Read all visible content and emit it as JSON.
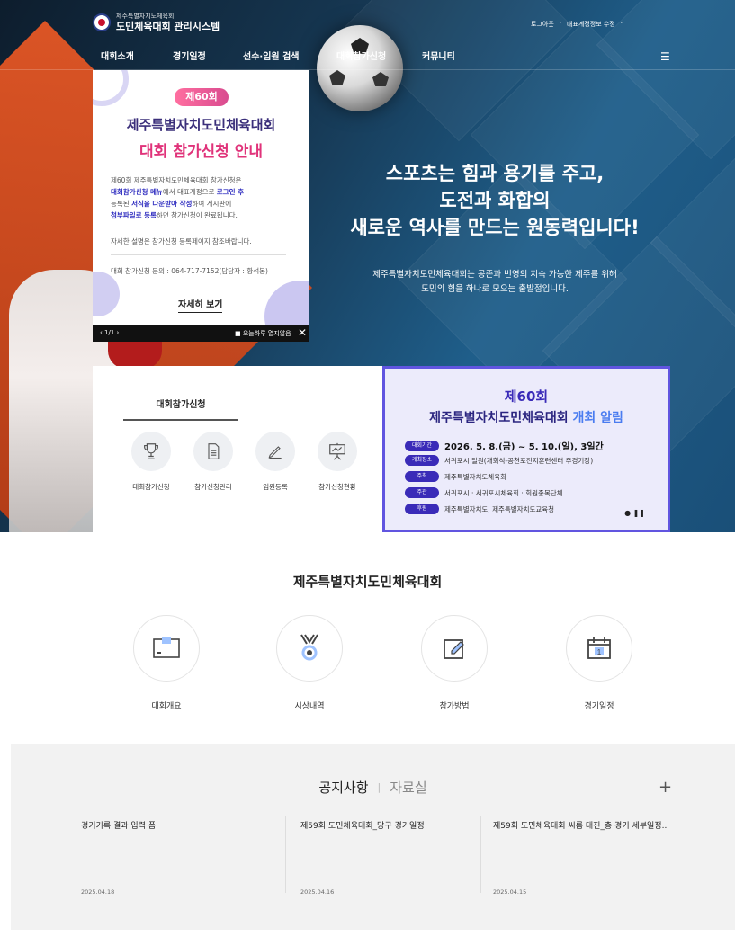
{
  "header": {
    "logo_sub": "제주특별자치도체육회",
    "logo_main": "도민체육대회 관리시스템",
    "util_logout": "로그아웃",
    "util_edit": "대표계정정보 수정",
    "nav": [
      "대회소개",
      "경기일정",
      "선수·임원 검색",
      "대회참가신청",
      "커뮤니티"
    ],
    "menu_icon": "☰"
  },
  "hero": {
    "line1": "스포츠는 힘과 용기를 주고,",
    "line2": "도전과 화합의",
    "line3": "새로운 역사를 만드는 원동력입니다!",
    "desc1": "제주특별자치도민체육대회는 공존과 번영의 지속 가능한 제주를 위해",
    "desc2": "도민의 힘을 하나로 모으는 출발점입니다."
  },
  "popup": {
    "badge": "제60회",
    "title1": "제주특별자치도민체육대회",
    "title2": "대회 참가신청 안내",
    "body_a": "제60회 제주특별자치도민체육대회 참가신청은",
    "body_b1": "대회참가신청 메뉴",
    "body_b2": "에서 대표계정으로 ",
    "body_b3": "로그인 후",
    "body_c1": "등록된 ",
    "body_c2": "서식을 다운받아 작성",
    "body_c3": "하여 게시판에",
    "body_d1": "첨부파일로 등록",
    "body_d2": "하면 참가신청이 완료됩니다.",
    "note": "자세한 설명은 참가신청 등록페이지 참조바랍니다.",
    "contact": "대회 참가신청 문의 : 064-717-7152(담당자 : 황석봉)",
    "more": "자세히 보기",
    "pager": "‹ 1/1 ›",
    "close_today": "■ 오늘하루 열지않음",
    "close_x": "✕"
  },
  "apply": {
    "title": "대회참가신청",
    "items": [
      "대회참가신청",
      "참가신청관리",
      "임원등록",
      "참가신청현황"
    ]
  },
  "event": {
    "t1": "제60회",
    "t2a": "제주특별자치도민체육대회 ",
    "t2b": "개최 알림",
    "rows": [
      {
        "tag": "대회기간",
        "text": "2026. 5. 8.(금) ~ 5. 10.(일), 3일간"
      },
      {
        "tag": "개최장소",
        "text": "서귀포시 일원(개회식-공천포전지훈련센터 주경기장)"
      },
      {
        "tag": "주최",
        "text": "제주특별자치도체육회"
      },
      {
        "tag": "주관",
        "text": "서귀포시 · 서귀포시체육회 · 회원종목단체"
      },
      {
        "tag": "후원",
        "text": "제주특별자치도, 제주특별자치도교육청"
      }
    ],
    "controls": "● ❚❚"
  },
  "intro": {
    "title": "제주특별자치도민체육대회",
    "items": [
      "대회개요",
      "시상내역",
      "참가방법",
      "경기일정"
    ]
  },
  "notice": {
    "tab_on": "공지사항",
    "tab_sep": "|",
    "tab_off": "자료실",
    "plus": "+",
    "items": [
      {
        "title": "경기기록 결과 입력 폼",
        "date": "2025.04.18"
      },
      {
        "title": "제59회 도민체육대회_당구 경기일정",
        "date": "2025.04.16"
      },
      {
        "title": "제59회 도민체육대회 씨름 대진_총 경기 세부일정..",
        "date": "2025.04.15"
      }
    ]
  }
}
